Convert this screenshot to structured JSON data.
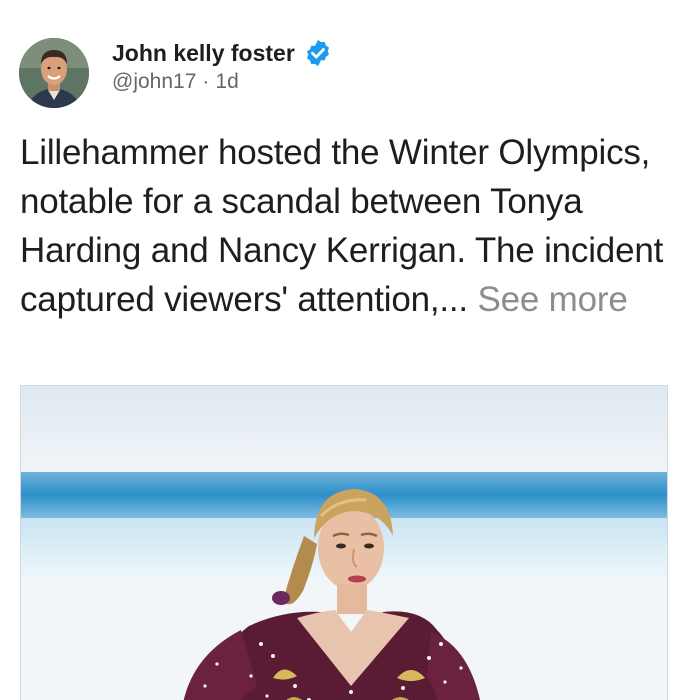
{
  "post": {
    "author": {
      "display_name": "John kelly foster",
      "handle": "@john17",
      "verified": true,
      "avatar_icon": "profile-photo"
    },
    "meta": {
      "separator": "·",
      "time_ago": "1d"
    },
    "body": {
      "text": "Lillehammer hosted the Winter Olympics, notable for a scandal between Tonya Harding and Nancy Kerrigan. The incident captured viewers' attention,... ",
      "see_more_label": "See more"
    },
    "media": {
      "type": "photo",
      "subject": "figure-skater-photo"
    },
    "colors": {
      "verified_badge": "#1d9bf0",
      "see_more": "#8a8d91",
      "rink_band": "#2c8fc9"
    }
  }
}
